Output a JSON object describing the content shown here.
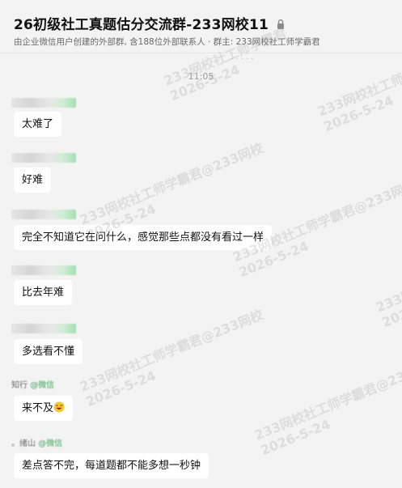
{
  "header": {
    "title": "26初级社工真题估分交流群-233网校11",
    "subtitle": "由企业微信用户创建的外部群, 含188位外部联系人 · 群主: 233网校社工师学霸君",
    "lock_icon": "lock-icon"
  },
  "chat": {
    "cutoff_text": "· · · · ·",
    "timestamp": "11:05",
    "messages": [
      {
        "text": "太难了"
      },
      {
        "text": "好难"
      },
      {
        "text": "完全不知道它在问什么，感觉那些点都没有看过一样"
      },
      {
        "text": "比去年难"
      },
      {
        "text": "多选看不懂"
      },
      {
        "text": "来不及",
        "emoji": "grinning-sweat-emoji"
      },
      {
        "text": "差点答不完，每道题都不能多想一秒钟"
      }
    ],
    "senders": [
      {
        "text": "",
        "tag": ""
      },
      {
        "text": "",
        "tag": ""
      },
      {
        "text": "",
        "tag": ""
      },
      {
        "text": "",
        "tag": ""
      },
      {
        "text": "",
        "tag": ""
      },
      {
        "text": "知行",
        "tag": "@微信"
      },
      {
        "text": "。绪山",
        "tag": "@微信"
      }
    ]
  },
  "watermarks": [
    {
      "line1": "233网校社工师学霸君",
      "line2": "2026-5-24"
    },
    {
      "line1": "233网校社工师学霸君@233网校",
      "line2": "2026-5-24"
    },
    {
      "line1": "233网校社工师学霸君@233网校",
      "line2": "2026-5-24"
    },
    {
      "line1": "233网校社工师学霸君@233网校",
      "line2": "2026-5-24"
    },
    {
      "line1": "233网校社工师学霸君@233网校",
      "line2": "2026-5-24"
    },
    {
      "line1": "233网校社工师学霸君@233网校",
      "line2": "2026-5-24"
    },
    {
      "line1": "233网校社工师学霸君@233网校",
      "line2": "2026-5-24"
    }
  ]
}
